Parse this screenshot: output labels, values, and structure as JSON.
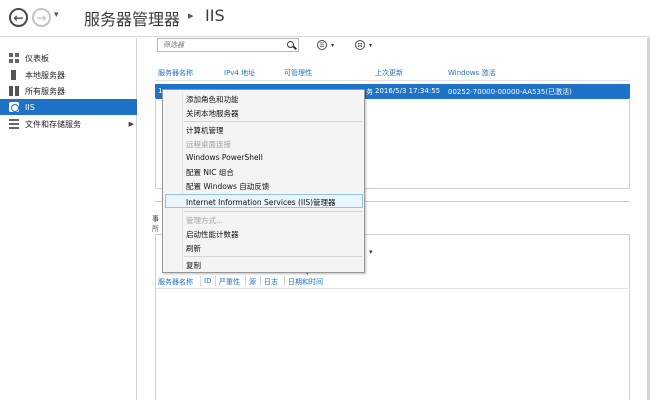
{
  "titlebar": {
    "back_glyph": "←",
    "forward_glyph": "→",
    "dropdown_glyph": "▾",
    "breadcrumb_root": "服务器管理器",
    "breadcrumb_sep": "▸",
    "breadcrumb_leaf": "IIS"
  },
  "sidebar": {
    "items": [
      {
        "label": "仪表板",
        "icon": "dashboard-icon"
      },
      {
        "label": "本地服务器",
        "icon": "server-icon"
      },
      {
        "label": "所有服务器",
        "icon": "servers-icon"
      },
      {
        "label": "IIS",
        "icon": "iis-icon",
        "selected": true
      },
      {
        "label": "文件和存储服务",
        "icon": "file-storage-icon",
        "expand_glyph": "▶"
      }
    ]
  },
  "toolbar": {
    "filter_placeholder": "筛选器",
    "list_btn_glyph": "☰",
    "save_btn_glyph": "⊟",
    "dropdown_glyph": "▾"
  },
  "servers_table": {
    "headers": [
      "服务器名称",
      "IPv4 地址",
      "可管理性",
      "上次更新",
      "Windows 激活"
    ],
    "row": {
      "name_fragment": "1",
      "suffix_fragment": "务",
      "last_update": "2016/5/3 17:34:55",
      "activation": "00252-70000-00000-AA535(已激活)"
    }
  },
  "events": {
    "title_fragment": "事",
    "subtitle_fragment": "所",
    "filter_arrow": "▾",
    "sort_glyph": "▾",
    "headers": [
      "服务器名称",
      "ID",
      "严重性",
      "源",
      "日志",
      "日期和时间"
    ]
  },
  "context_menu": {
    "items": [
      {
        "label": "添加角色和功能",
        "enabled": true
      },
      {
        "label": "关闭本地服务器",
        "enabled": true
      },
      {
        "label": "计算机管理",
        "enabled": true
      },
      {
        "label": "远程桌面连接",
        "enabled": false
      },
      {
        "label": "Windows PowerShell",
        "enabled": true
      },
      {
        "label": "配置 NIC 组合",
        "enabled": true
      },
      {
        "label": "配置 Windows 自动反馈",
        "enabled": true
      },
      {
        "label": "Internet Information Services (IIS)管理器",
        "enabled": true,
        "highlighted": true
      },
      {
        "label": "管理方式...",
        "enabled": false
      },
      {
        "label": "启动性能计数器",
        "enabled": true
      },
      {
        "label": "刷新",
        "enabled": true
      },
      {
        "label": "复制",
        "enabled": true
      }
    ]
  },
  "colors": {
    "accent": "#1e73c8",
    "menu_bg": "#f4f4f4",
    "highlight_border": "#8ec5ef"
  }
}
